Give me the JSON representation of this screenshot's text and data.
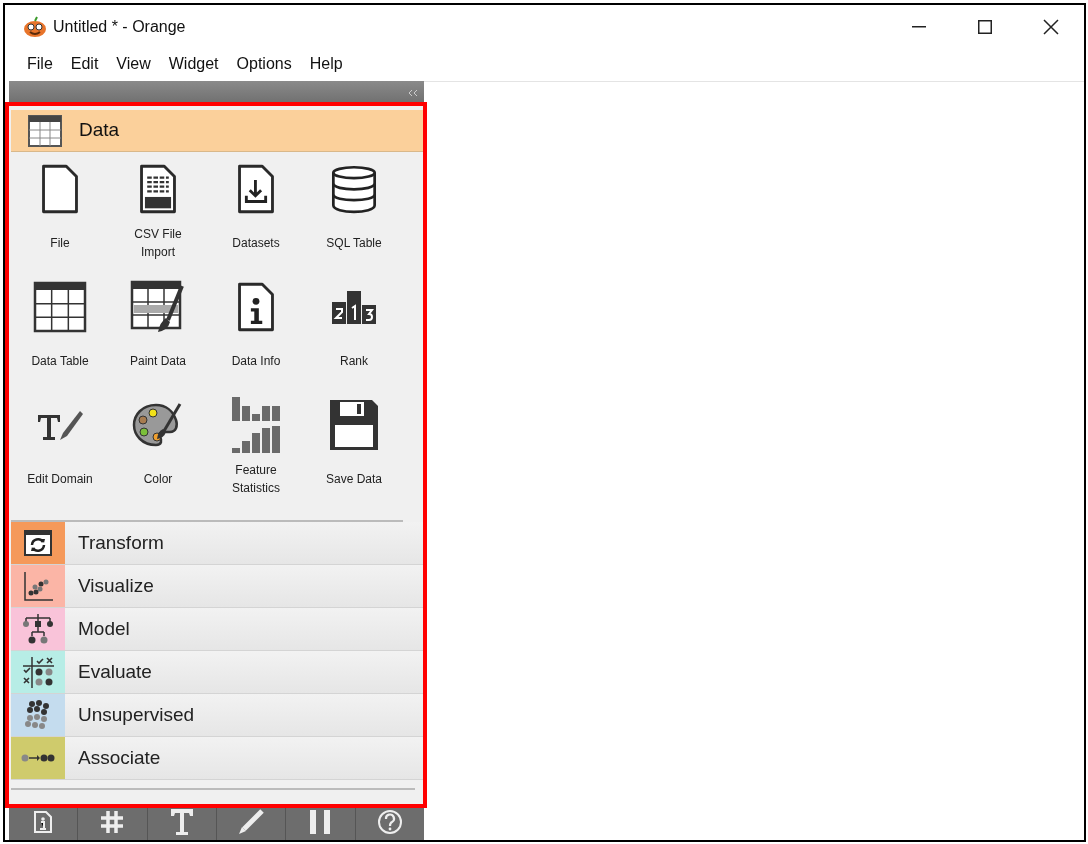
{
  "window": {
    "title": "Untitled * - Orange"
  },
  "menu": [
    "File",
    "Edit",
    "View",
    "Widget",
    "Options",
    "Help"
  ],
  "categories": [
    {
      "name": "Data",
      "color": "#fbd09b",
      "expanded": true,
      "widgets": [
        {
          "label": "File"
        },
        {
          "label": "CSV File\nImport"
        },
        {
          "label": "Datasets"
        },
        {
          "label": "SQL Table"
        },
        {
          "label": "Data Table"
        },
        {
          "label": "Paint Data"
        },
        {
          "label": "Data Info"
        },
        {
          "label": "Rank"
        },
        {
          "label": "Edit Domain"
        },
        {
          "label": "Color"
        },
        {
          "label": "Feature\nStatistics"
        },
        {
          "label": "Save Data"
        }
      ]
    },
    {
      "name": "Transform",
      "color": "#f5995a",
      "expanded": false
    },
    {
      "name": "Visualize",
      "color": "#fbb5a6",
      "expanded": false
    },
    {
      "name": "Model",
      "color": "#f9c3d9",
      "expanded": false
    },
    {
      "name": "Evaluate",
      "color": "#b7ede6",
      "expanded": false
    },
    {
      "name": "Unsupervised",
      "color": "#c4dcee",
      "expanded": false
    },
    {
      "name": "Associate",
      "color": "#cfcb6c",
      "expanded": false
    }
  ]
}
